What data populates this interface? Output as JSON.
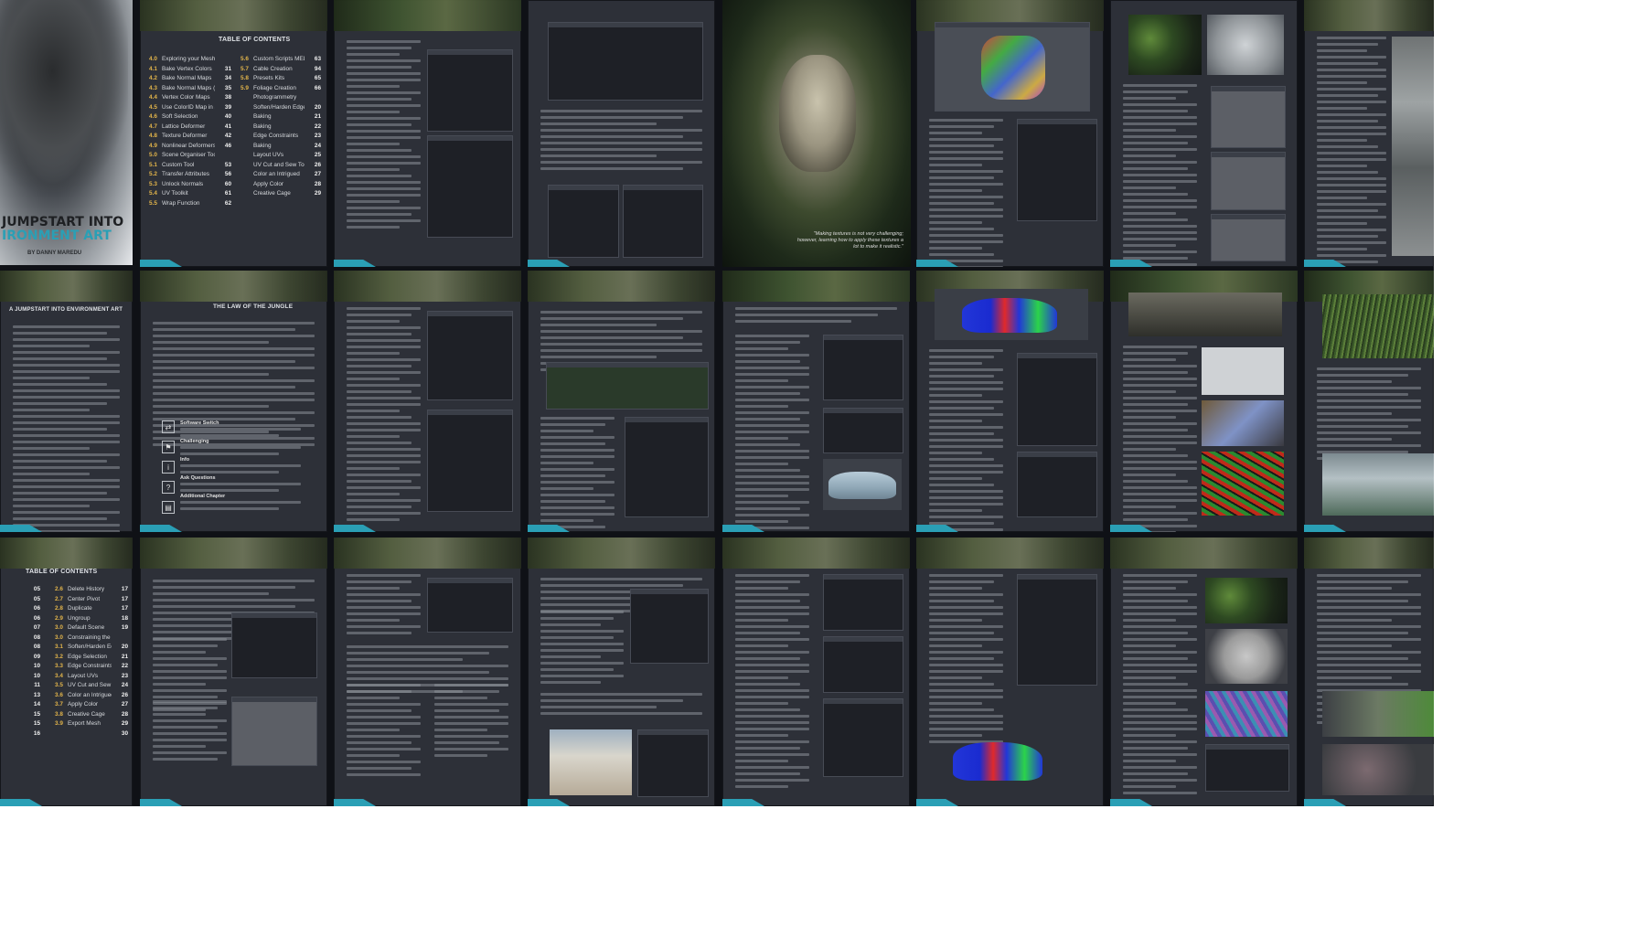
{
  "colors": {
    "accent": "#2a9fb5",
    "section_number": "#e3b54a",
    "page_bg": "#2d3038"
  },
  "cover": {
    "title_line1": "JUMPSTART INTO",
    "title_line2": "IRONMENT ART",
    "author": "BY DANNY MAREDU"
  },
  "toc_top": {
    "heading": "TABLE OF CONTENTS",
    "left": [
      {
        "n": "4.0",
        "t": "Exploring your Mesh",
        "p": ""
      },
      {
        "n": "4.1",
        "t": "Bake Vertex Colors",
        "p": "31"
      },
      {
        "n": "4.2",
        "t": "Bake Normal Maps",
        "p": "34"
      },
      {
        "n": "4.3",
        "t": "Bake Normal Maps (cont.)",
        "p": "35"
      },
      {
        "n": "4.4",
        "t": "Vertex Color Maps",
        "p": "38"
      },
      {
        "n": "4.5",
        "t": "Use ColorID Map in Substance",
        "p": "39"
      },
      {
        "n": "4.6",
        "t": "Soft Selection",
        "p": "40"
      },
      {
        "n": "4.7",
        "t": "Lattice Deformer",
        "p": "41"
      },
      {
        "n": "4.8",
        "t": "Texture Deformer",
        "p": "42"
      },
      {
        "n": "4.9",
        "t": "Nonlinear Deformers",
        "p": "46"
      },
      {
        "n": "5.0",
        "t": "Scene Organiser Tool",
        "p": ""
      },
      {
        "n": "5.1",
        "t": "Custom Tool",
        "p": "53"
      },
      {
        "n": "5.2",
        "t": "Transfer Attributes",
        "p": "56"
      },
      {
        "n": "5.3",
        "t": "Unlock Normals",
        "p": "60"
      },
      {
        "n": "5.4",
        "t": "UV Toolkit",
        "p": "61"
      },
      {
        "n": "5.5",
        "t": "Wrap Function",
        "p": "62"
      }
    ],
    "right": [
      {
        "n": "5.6",
        "t": "Custom Scripts MEL",
        "p": "63"
      },
      {
        "n": "5.7",
        "t": "Cable Creation",
        "p": "94"
      },
      {
        "n": "5.8",
        "t": "Presets Kits",
        "p": "65"
      },
      {
        "n": "5.9",
        "t": "Foliage Creation",
        "p": "66"
      },
      {
        "n": "",
        "t": "Photogrammetry",
        "p": ""
      },
      {
        "n": "",
        "t": "Soften/Harden Edges",
        "p": "20"
      },
      {
        "n": "",
        "t": "Baking",
        "p": "21"
      },
      {
        "n": "",
        "t": "Baking",
        "p": "22"
      },
      {
        "n": "",
        "t": "Edge Constraints",
        "p": "23"
      },
      {
        "n": "",
        "t": "Baking",
        "p": "24"
      },
      {
        "n": "",
        "t": "Layout UVs",
        "p": "25"
      },
      {
        "n": "",
        "t": "UV Cut and Sew Tool",
        "p": "26"
      },
      {
        "n": "",
        "t": "Color an Intrigued",
        "p": "27"
      },
      {
        "n": "",
        "t": "Apply Color",
        "p": "28"
      },
      {
        "n": "",
        "t": "Creative Cage",
        "p": "29"
      }
    ]
  },
  "toc_bottom": {
    "heading": "TABLE OF CONTENTS",
    "right": [
      {
        "n": "2.6",
        "t": "Delete History",
        "p": "17"
      },
      {
        "n": "2.7",
        "t": "Center Pivot",
        "p": "17"
      },
      {
        "n": "2.8",
        "t": "Duplicate",
        "p": "17"
      },
      {
        "n": "2.9",
        "t": "Ungroup",
        "p": "18"
      },
      {
        "n": "3.0",
        "t": "Default Scene",
        "p": "19"
      },
      {
        "n": "3.0",
        "t": "Constraining the Edges",
        "p": ""
      },
      {
        "n": "3.1",
        "t": "Soften/Harden Edges",
        "p": "20"
      },
      {
        "n": "3.2",
        "t": "Edge Selection",
        "p": "21"
      },
      {
        "n": "3.3",
        "t": "Edge Constraints",
        "p": "22"
      },
      {
        "n": "3.4",
        "t": "Layout UVs",
        "p": "23"
      },
      {
        "n": "3.5",
        "t": "UV Cut and Sew Tool",
        "p": "24"
      },
      {
        "n": "3.6",
        "t": "Color an Intrigued",
        "p": "26"
      },
      {
        "n": "3.7",
        "t": "Apply Color",
        "p": "27"
      },
      {
        "n": "3.8",
        "t": "Creative Cage",
        "p": "28"
      },
      {
        "n": "3.9",
        "t": "Export Mesh",
        "p": "29"
      },
      {
        "n": "",
        "t": "",
        "p": "30"
      }
    ],
    "left_pages": [
      "05",
      "05",
      "06",
      "06",
      "07",
      "08",
      "08",
      "09",
      "10",
      "10",
      "11",
      "13",
      "14",
      "15",
      "15",
      "16"
    ]
  },
  "titles": {
    "jumpstart": "A JUMPSTART INTO ENVIRONMENT ART",
    "law": "THE LAW OF THE JUNGLE"
  },
  "buddha_quote": "\"Making textures is not very challenging; however, learning how to apply these textures a lot to make it realistic.\"",
  "law_items": [
    "Software Switch",
    "Challenging",
    "Info",
    "Ask Questions",
    "Additional Chapter"
  ]
}
